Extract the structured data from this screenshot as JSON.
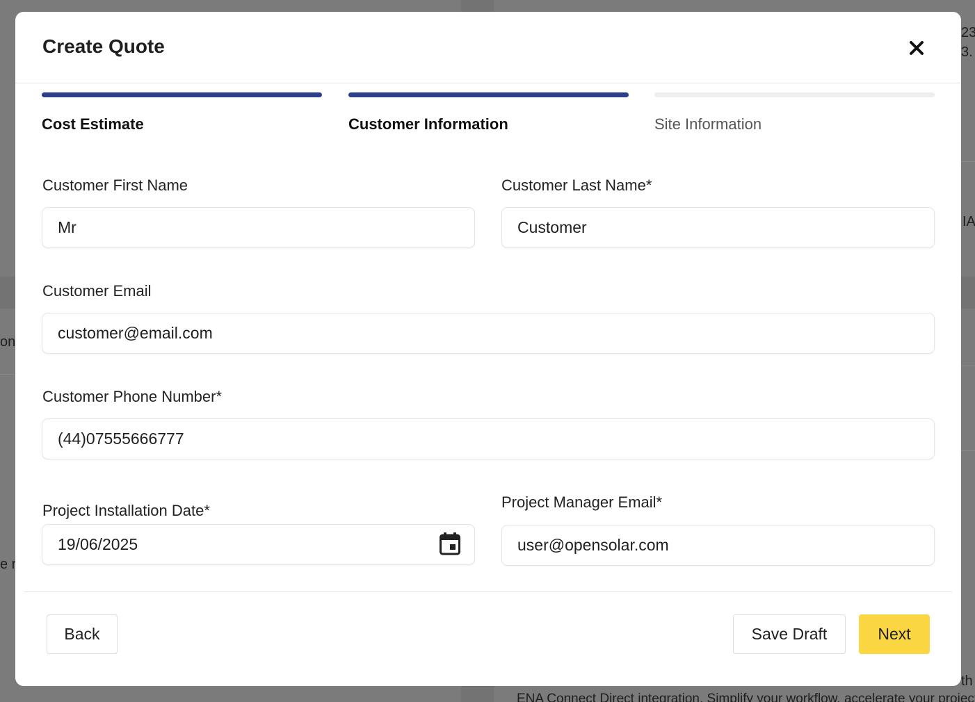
{
  "background": {
    "fragments": [
      "23",
      "3.",
      "IAC",
      "on",
      "e r",
      "th",
      "ENA Connect Direct integration. Simplify your workflow, accelerate your project"
    ]
  },
  "modal": {
    "title": "Create Quote",
    "close_icon": "close-icon"
  },
  "stepper": {
    "steps": [
      {
        "label": "Cost Estimate",
        "state": "complete"
      },
      {
        "label": "Customer Information",
        "state": "complete"
      },
      {
        "label": "Site Information",
        "state": "pending"
      }
    ],
    "active_color": "#2d3e8c",
    "inactive_color": "#edeef0"
  },
  "form": {
    "first_name": {
      "label": "Customer First Name",
      "value": "Mr"
    },
    "last_name": {
      "label": "Customer Last Name*",
      "value": "Customer"
    },
    "email": {
      "label": "Customer Email",
      "value": "customer@email.com"
    },
    "phone": {
      "label": "Customer Phone Number*",
      "value": "(44)07555666777"
    },
    "install_date": {
      "label": "Project Installation Date*",
      "value": "19/06/2025",
      "icon": "calendar-icon"
    },
    "manager_email": {
      "label": "Project Manager Email*",
      "value": "user@opensolar.com"
    }
  },
  "footer": {
    "back_label": "Back",
    "save_draft_label": "Save Draft",
    "next_label": "Next",
    "next_color": "#fad643"
  }
}
